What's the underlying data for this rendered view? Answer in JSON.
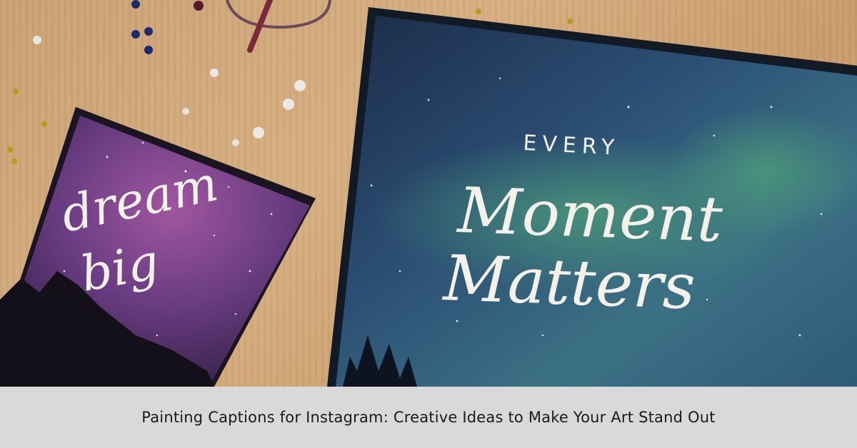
{
  "photo": {
    "small_canvas": {
      "line1": "dream",
      "line2": "big"
    },
    "large_canvas": {
      "line1": "EVERY",
      "line2": "Moment",
      "line3": "Matters"
    }
  },
  "caption": {
    "title": "Painting Captions for Instagram: Creative Ideas to Make Your Art Stand Out"
  },
  "colors": {
    "caption_bar": "#d9d9d9",
    "table_wood": "#d2a676",
    "small_canvas_sky": "#6b3f7e",
    "large_canvas_sky": "#1f3f63"
  }
}
